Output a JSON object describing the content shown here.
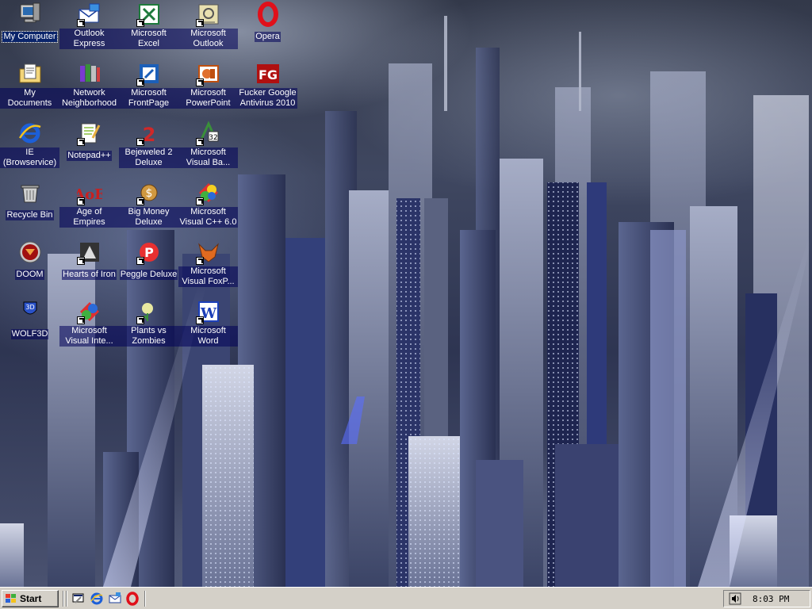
{
  "desktop": {
    "icons": [
      {
        "id": "my-computer",
        "label": "My Computer",
        "icon": "my-computer-icon",
        "shortcut": false,
        "selected": true
      },
      {
        "id": "my-documents",
        "label": "My Documents",
        "icon": "my-documents-icon",
        "shortcut": false
      },
      {
        "id": "ie",
        "label": "IE (Browservice)",
        "icon": "internet-explorer-icon",
        "shortcut": false
      },
      {
        "id": "recycle-bin",
        "label": "Recycle Bin",
        "icon": "recycle-bin-icon",
        "shortcut": false
      },
      {
        "id": "doom",
        "label": "DOOM",
        "icon": "doom-icon",
        "shortcut": false
      },
      {
        "id": "wolf3d",
        "label": "WOLF3D",
        "icon": "wolf3d-icon",
        "shortcut": false
      },
      {
        "id": "outlook-express",
        "label": "Outlook Express",
        "icon": "outlook-express-icon",
        "shortcut": true
      },
      {
        "id": "network-neighborhood",
        "label": "Network Neighborhood",
        "icon": "network-neighborhood-icon",
        "shortcut": false
      },
      {
        "id": "notepadpp",
        "label": "Notepad++",
        "icon": "notepad-plus-plus-icon",
        "shortcut": true
      },
      {
        "id": "age-of-empires",
        "label": "Age of Empires",
        "icon": "age-of-empires-icon",
        "shortcut": true
      },
      {
        "id": "hearts-of-iron",
        "label": "Hearts of Iron",
        "icon": "hearts-of-iron-icon",
        "shortcut": true
      },
      {
        "id": "ms-visual-interdev",
        "label": "Microsoft Visual Inte...",
        "icon": "visual-interdev-icon",
        "shortcut": true
      },
      {
        "id": "ms-excel",
        "label": "Microsoft Excel",
        "icon": "excel-icon",
        "shortcut": true
      },
      {
        "id": "ms-frontpage",
        "label": "Microsoft FrontPage",
        "icon": "frontpage-icon",
        "shortcut": true
      },
      {
        "id": "bejeweled2",
        "label": "Bejeweled 2 Deluxe",
        "icon": "bejeweled-icon",
        "shortcut": true
      },
      {
        "id": "big-money",
        "label": "Big Money Deluxe",
        "icon": "big-money-icon",
        "shortcut": true
      },
      {
        "id": "peggle",
        "label": "Peggle Deluxe",
        "icon": "peggle-icon",
        "shortcut": true
      },
      {
        "id": "pvz",
        "label": "Plants vs Zombies",
        "icon": "plants-vs-zombies-icon",
        "shortcut": true
      },
      {
        "id": "ms-outlook",
        "label": "Microsoft Outlook",
        "icon": "outlook-icon",
        "shortcut": true
      },
      {
        "id": "ms-powerpoint",
        "label": "Microsoft PowerPoint",
        "icon": "powerpoint-icon",
        "shortcut": true
      },
      {
        "id": "ms-visual-basic",
        "label": "Microsoft Visual Ba...",
        "icon": "visual-basic-icon",
        "shortcut": true
      },
      {
        "id": "ms-visual-cpp",
        "label": "Microsoft Visual C++ 6.0",
        "icon": "visual-cpp-icon",
        "shortcut": true
      },
      {
        "id": "ms-visual-foxpro",
        "label": "Microsoft Visual FoxP...",
        "icon": "visual-foxpro-icon",
        "shortcut": true
      },
      {
        "id": "ms-word",
        "label": "Microsoft Word",
        "icon": "word-icon",
        "shortcut": true
      },
      {
        "id": "opera",
        "label": "Opera",
        "icon": "opera-icon",
        "shortcut": false
      },
      {
        "id": "fg-antivirus",
        "label": "Fucker Google Antivirus 2010",
        "icon": "fg-antivirus-icon",
        "shortcut": false
      }
    ]
  },
  "taskbar": {
    "start_label": "Start",
    "quick_launch": [
      {
        "id": "show-desktop",
        "icon": "show-desktop-icon"
      },
      {
        "id": "ie",
        "icon": "internet-explorer-icon"
      },
      {
        "id": "outlook-express",
        "icon": "outlook-express-icon"
      },
      {
        "id": "opera",
        "icon": "opera-icon"
      }
    ],
    "tray_icon": "volume-icon",
    "clock": "8:03 PM"
  },
  "colors": {
    "taskbar": "#d4d0c8",
    "selection": "#0a246a",
    "label_text": "#ffffff"
  }
}
